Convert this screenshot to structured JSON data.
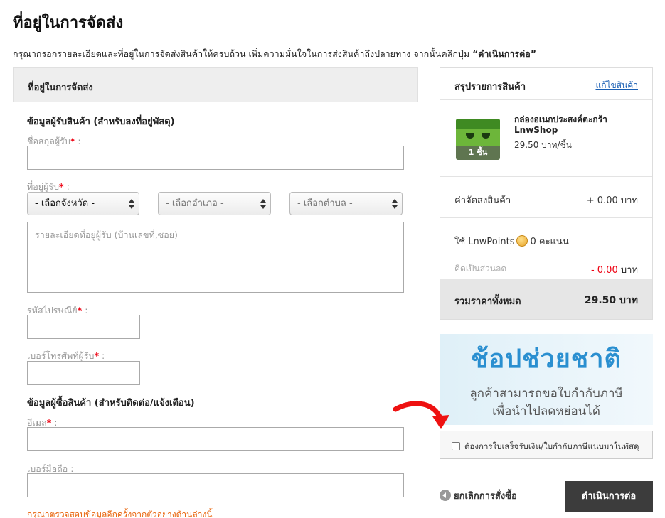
{
  "page": {
    "title": "ที่อยู่ในการจัดส่ง",
    "description_prefix": "กรุณากรอกรายละเอียดและที่อยู่ในการจัดส่งสินค้าให้ครบถ้วน เพิ่มความมั่นใจในการส่งสินค้าถึงปลายทาง จากนั้นคลิกปุ่ม ",
    "description_button": "“ดำเนินการต่อ”"
  },
  "form": {
    "header": "ที่อยู่ในการจัดส่ง",
    "recipient_section": "ข้อมูลผู้รับสินค้า (สำหรับลงที่อยู่พัสดุ)",
    "name_label": "ชื่อสกุลผู้รับ",
    "name_value": "",
    "address_label": "ที่อยู่ผู้รับ",
    "province_select": "- เลือกจังหวัด -",
    "district_select": "- เลือกอำเภอ -",
    "subdistrict_select": "- เลือกตำบล -",
    "address_placeholder": "รายละเอียดที่อยู่ผู้รับ (บ้านเลขที่,ซอย)",
    "postcode_label": "รหัสไปรษณีย์",
    "postcode_value": "",
    "phone_label": "เบอร์โทรศัพท์ผู้รับ",
    "phone_value": "",
    "buyer_section": "ข้อมูลผู้ซื้อสินค้า (สำหรับติดต่อ/แจ้งเตือน)",
    "email_label": "อีเมล",
    "email_value": "",
    "mobile_label": "เบอร์มือถือ :",
    "mobile_value": "",
    "required_mark": "*",
    "colon": " :",
    "hint": "กรุณาตรวจสอบข้อมูลอีกครั้งจากตัวอย่างด้านล่างนี้"
  },
  "summary": {
    "title": "สรุปรายการสินค้า",
    "edit_link": "แก้ไขสินค้า",
    "product": {
      "name": "กล่องอเนกประสงค์ตะกร้า LnwShop",
      "price": "29.50 บาท/ชิ้น",
      "qty": "1 ชิ้น"
    },
    "shipping_label": "ค่าจัดส่งสินค้า",
    "shipping_value": "+ 0.00 บาท",
    "points_prefix": "ใช้ LnwPoints",
    "points_suffix": "0 คะแนน",
    "discount_label": "คิดเป็นส่วนลด",
    "discount_value": "- 0.00",
    "discount_unit": " บาท",
    "total_label": "รวมราคาทั้งหมด",
    "total_value": "29.50 บาท"
  },
  "banner": {
    "headline": "ช้อปช่วยชาติ",
    "line1": "ลูกค้าสามารถขอใบกำกับภาษี",
    "line2": "เพื่อนำไปลดหย่อนได้"
  },
  "invoice_checkbox_label": "ต้องการใบเสร็จรับเงิน/ใบกำกับภาษีแนบมาในพัสดุ",
  "actions": {
    "cancel": "ยกเลิกการสั่งซื้อ",
    "continue": "ดำเนินการต่อ"
  },
  "colors": {
    "required": "#ee1111",
    "hint": "#e8630a",
    "link": "#1a5fb4",
    "arrow": "#ee1111",
    "button": "#3c3c3c"
  },
  "icons": [
    "product-thumbnail",
    "lnwpoints-coin-icon",
    "back-arrow-icon",
    "red-curved-arrow-icon",
    "select-arrows-icon"
  ]
}
